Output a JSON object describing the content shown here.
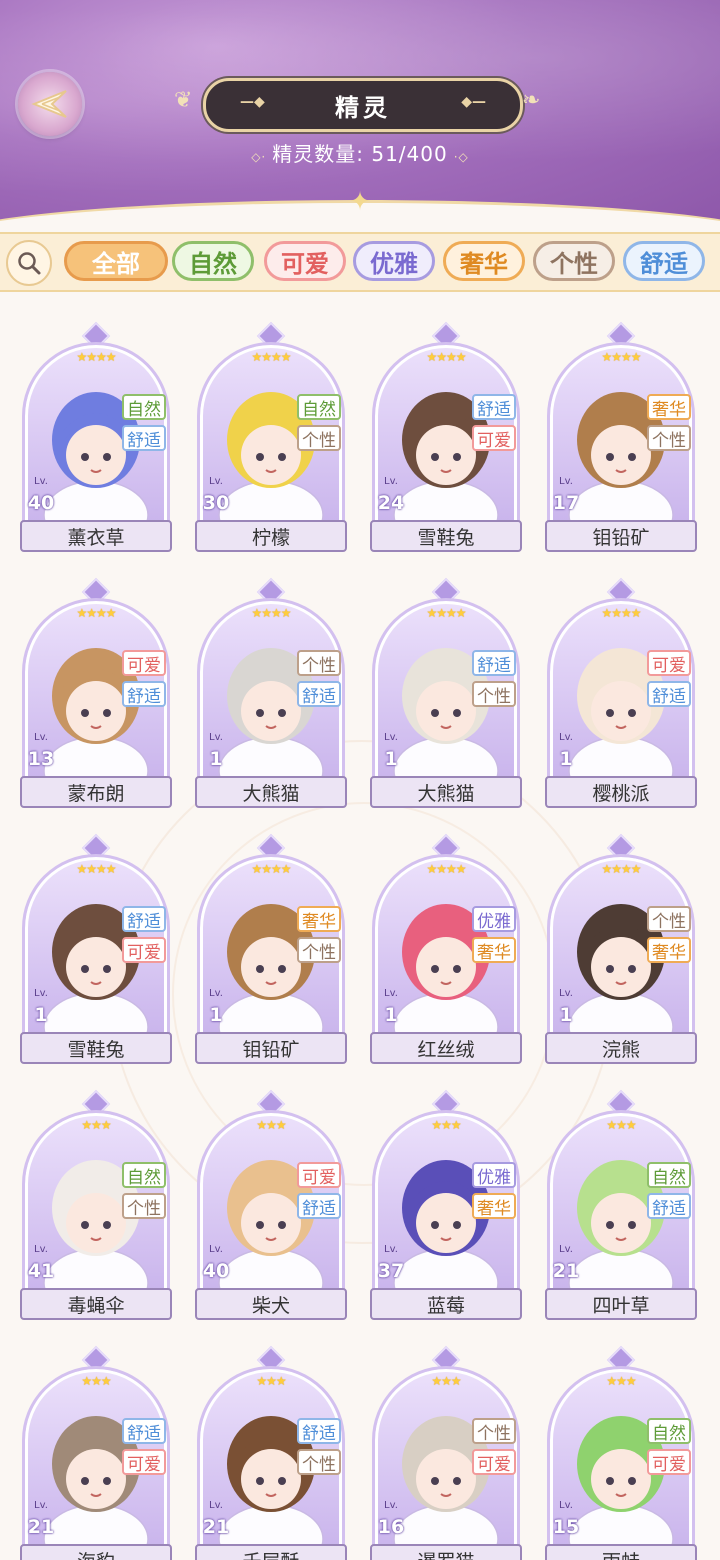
{
  "header": {
    "title": "精灵",
    "count_label": "精灵数量: ",
    "count_value": "51/400"
  },
  "filters": [
    {
      "label": "全部",
      "color": "#e79b4c",
      "bg": "#f6c27a",
      "text": "#ffffff",
      "active": true
    },
    {
      "label": "自然",
      "color": "#8fbf6a",
      "bg": "#eef8e3",
      "text": "#5d9b37"
    },
    {
      "label": "可爱",
      "color": "#f29a9a",
      "bg": "#fdeceb",
      "text": "#e2605f"
    },
    {
      "label": "优雅",
      "color": "#a79be0",
      "bg": "#f0edfc",
      "text": "#7a6ad0"
    },
    {
      "label": "奢华",
      "color": "#efab55",
      "bg": "#fff1dd",
      "text": "#df8a22"
    },
    {
      "label": "个性",
      "color": "#bda08a",
      "bg": "#f6eee6",
      "text": "#8e7360"
    },
    {
      "label": "舒适",
      "color": "#8fb6e8",
      "bg": "#ebf3fd",
      "text": "#4f8ed8"
    }
  ],
  "tag_colors": {
    "自然": {
      "border": "#8fbf6a",
      "text": "#5d9b37"
    },
    "可爱": {
      "border": "#f29a9a",
      "text": "#e2605f"
    },
    "优雅": {
      "border": "#a79be0",
      "text": "#7a6ad0"
    },
    "奢华": {
      "border": "#efab55",
      "text": "#df8a22"
    },
    "个性": {
      "border": "#bda08a",
      "text": "#8e7360"
    },
    "舒适": {
      "border": "#8fb6e8",
      "text": "#4f8ed8"
    }
  },
  "spirits": [
    {
      "name": "薰衣草",
      "level": "40",
      "stars": 4,
      "tags": [
        "自然",
        "舒适"
      ],
      "hair": "#6f7de0",
      "skin": "#fbe8df"
    },
    {
      "name": "柠檬",
      "level": "30",
      "stars": 4,
      "tags": [
        "自然",
        "个性"
      ],
      "hair": "#f0d24a",
      "skin": "#fbe8df"
    },
    {
      "name": "雪鞋兔",
      "level": "24",
      "stars": 4,
      "tags": [
        "舒适",
        "可爱"
      ],
      "hair": "#6e4e3e",
      "skin": "#fbe8df"
    },
    {
      "name": "钼铅矿",
      "level": "17",
      "stars": 4,
      "tags": [
        "奢华",
        "个性"
      ],
      "hair": "#b07e4c",
      "skin": "#fbe8df"
    },
    {
      "name": "蒙布朗",
      "level": "13",
      "stars": 4,
      "tags": [
        "可爱",
        "舒适"
      ],
      "hair": "#c79562",
      "skin": "#fbe8df"
    },
    {
      "name": "大熊猫",
      "level": "1",
      "stars": 4,
      "tags": [
        "个性",
        "舒适"
      ],
      "hair": "#d9d6d2",
      "skin": "#fbe8df"
    },
    {
      "name": "大熊猫",
      "level": "1",
      "stars": 4,
      "tags": [
        "舒适",
        "个性"
      ],
      "hair": "#e8e3da",
      "skin": "#fbe8df"
    },
    {
      "name": "樱桃派",
      "level": "1",
      "stars": 4,
      "tags": [
        "可爱",
        "舒适"
      ],
      "hair": "#f4e6d6",
      "skin": "#fbe8df"
    },
    {
      "name": "雪鞋兔",
      "level": "1",
      "stars": 4,
      "tags": [
        "舒适",
        "可爱"
      ],
      "hair": "#6e4e3e",
      "skin": "#fbe8df"
    },
    {
      "name": "钼铅矿",
      "level": "1",
      "stars": 4,
      "tags": [
        "奢华",
        "个性"
      ],
      "hair": "#b07e4c",
      "skin": "#fbe8df"
    },
    {
      "name": "红丝绒",
      "level": "1",
      "stars": 4,
      "tags": [
        "优雅",
        "奢华"
      ],
      "hair": "#e8607e",
      "skin": "#fbe8df"
    },
    {
      "name": "浣熊",
      "level": "1",
      "stars": 4,
      "tags": [
        "个性",
        "奢华"
      ],
      "hair": "#4e3c34",
      "skin": "#fbe8df"
    },
    {
      "name": "毒蝇伞",
      "level": "41",
      "stars": 3,
      "tags": [
        "自然",
        "个性"
      ],
      "hair": "#f1ece8",
      "skin": "#fbe8df"
    },
    {
      "name": "柴犬",
      "level": "40",
      "stars": 3,
      "tags": [
        "可爱",
        "舒适"
      ],
      "hair": "#e9c08e",
      "skin": "#fbe8df"
    },
    {
      "name": "蓝莓",
      "level": "37",
      "stars": 3,
      "tags": [
        "优雅",
        "奢华"
      ],
      "hair": "#5a4fb8",
      "skin": "#fbe8df"
    },
    {
      "name": "四叶草",
      "level": "21",
      "stars": 3,
      "tags": [
        "自然",
        "舒适"
      ],
      "hair": "#b7e08e",
      "skin": "#fbe8df"
    },
    {
      "name": "海豹",
      "level": "21",
      "stars": 3,
      "tags": [
        "舒适",
        "可爱"
      ],
      "hair": "#a08a78",
      "skin": "#fbe8df"
    },
    {
      "name": "千层酥",
      "level": "21",
      "stars": 3,
      "tags": [
        "舒适",
        "个性"
      ],
      "hair": "#7a5034",
      "skin": "#fbe8df"
    },
    {
      "name": "暹罗猫",
      "level": "16",
      "stars": 3,
      "tags": [
        "个性",
        "可爱"
      ],
      "hair": "#d8cfc4",
      "skin": "#fbe8df"
    },
    {
      "name": "雨蛙",
      "level": "15",
      "stars": 3,
      "tags": [
        "自然",
        "可爱"
      ],
      "hair": "#8fd26e",
      "skin": "#fbe8df"
    }
  ]
}
